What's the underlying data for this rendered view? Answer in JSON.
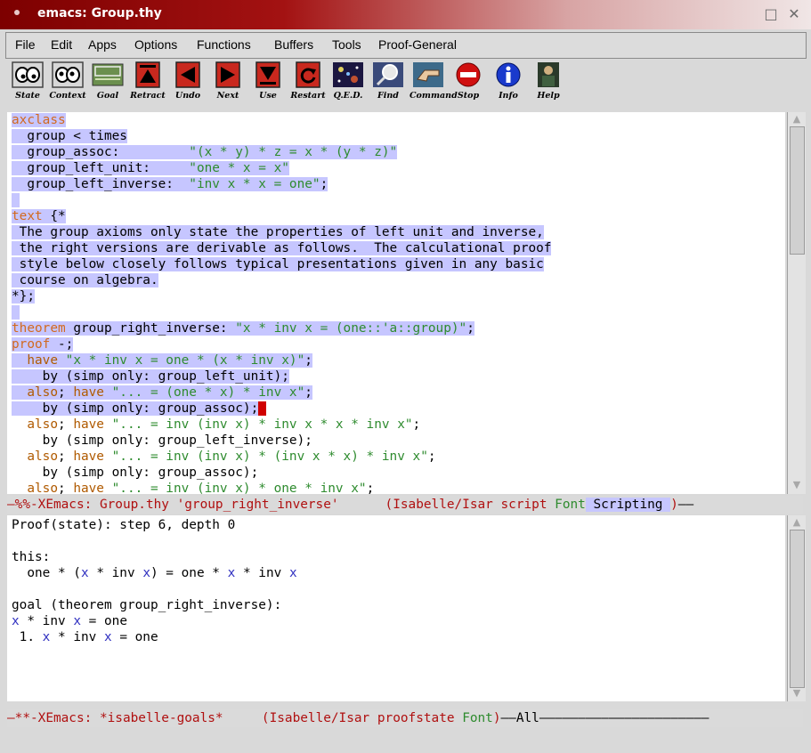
{
  "window": {
    "title": "emacs: Group.thy",
    "maximize_glyph": "□",
    "close_glyph": "✕"
  },
  "menu": {
    "items": [
      "File",
      "Edit",
      "Apps",
      "Options",
      "Functions",
      "Buffers",
      "Tools",
      "Proof-General"
    ],
    "help": "Help"
  },
  "toolbar": {
    "buttons": [
      {
        "label": "State",
        "icon": "eyes-icon"
      },
      {
        "label": "Context",
        "icon": "eyes-context-icon"
      },
      {
        "label": "Goal",
        "icon": "goal-icon"
      },
      {
        "label": "Retract",
        "icon": "retract-icon"
      },
      {
        "label": "Undo",
        "icon": "undo-icon"
      },
      {
        "label": "Next",
        "icon": "next-icon"
      },
      {
        "label": "Use",
        "icon": "use-icon"
      },
      {
        "label": "Restart",
        "icon": "restart-icon"
      },
      {
        "label": "Q.E.D.",
        "icon": "qed-icon"
      },
      {
        "label": "Find",
        "icon": "find-icon"
      },
      {
        "label": "Command",
        "icon": "command-icon"
      },
      {
        "label": "Stop",
        "icon": "stop-icon"
      },
      {
        "label": "Info",
        "icon": "info-icon"
      },
      {
        "label": "Help",
        "icon": "help-icon"
      }
    ]
  },
  "script": {
    "lines": [
      {
        "hl": true,
        "segs": [
          {
            "c": "kw",
            "t": "axclass"
          }
        ]
      },
      {
        "hl": true,
        "segs": [
          {
            "c": "",
            "t": "  group < times"
          }
        ]
      },
      {
        "hl": true,
        "segs": [
          {
            "c": "",
            "t": "  group_assoc:         "
          },
          {
            "c": "str",
            "t": "\"(x * y) * z = x * (y * z)\""
          }
        ]
      },
      {
        "hl": true,
        "segs": [
          {
            "c": "",
            "t": "  group_left_unit:     "
          },
          {
            "c": "str",
            "t": "\"one * x = x\""
          }
        ]
      },
      {
        "hl": true,
        "segs": [
          {
            "c": "",
            "t": "  group_left_inverse:  "
          },
          {
            "c": "str",
            "t": "\"inv x * x = one\""
          },
          {
            "c": "",
            "t": ";"
          }
        ]
      },
      {
        "hl": true,
        "segs": [
          {
            "c": "",
            "t": ""
          }
        ]
      },
      {
        "hl": true,
        "segs": [
          {
            "c": "kw",
            "t": "text"
          },
          {
            "c": "",
            "t": " {*"
          }
        ]
      },
      {
        "hl": true,
        "segs": [
          {
            "c": "",
            "t": " The group axioms only state the properties of left unit and inverse,"
          }
        ]
      },
      {
        "hl": true,
        "segs": [
          {
            "c": "",
            "t": " the right versions are derivable as follows.  The calculational proof"
          }
        ]
      },
      {
        "hl": true,
        "segs": [
          {
            "c": "",
            "t": " style below closely follows typical presentations given in any basic"
          }
        ]
      },
      {
        "hl": true,
        "segs": [
          {
            "c": "",
            "t": " course on algebra."
          }
        ]
      },
      {
        "hl": true,
        "segs": [
          {
            "c": "",
            "t": "*};"
          }
        ]
      },
      {
        "hl": true,
        "segs": [
          {
            "c": "",
            "t": ""
          }
        ]
      },
      {
        "hl": true,
        "segs": [
          {
            "c": "kw",
            "t": "theorem"
          },
          {
            "c": "",
            "t": " group_right_inverse: "
          },
          {
            "c": "str",
            "t": "\"x * inv x = (one::'a::group)\""
          },
          {
            "c": "",
            "t": ";"
          }
        ]
      },
      {
        "hl": true,
        "segs": [
          {
            "c": "kw",
            "t": "proof"
          },
          {
            "c": "",
            "t": " -;"
          }
        ]
      },
      {
        "hl": true,
        "segs": [
          {
            "c": "ph",
            "t": "  have"
          },
          {
            "c": "",
            "t": " "
          },
          {
            "c": "str",
            "t": "\"x * inv x = one * (x * inv x)\""
          },
          {
            "c": "",
            "t": ";"
          }
        ]
      },
      {
        "hl": true,
        "segs": [
          {
            "c": "",
            "t": "    by (simp only: group_left_unit);"
          }
        ]
      },
      {
        "hl": true,
        "segs": [
          {
            "c": "ph",
            "t": "  also"
          },
          {
            "c": "",
            "t": "; "
          },
          {
            "c": "ph",
            "t": "have"
          },
          {
            "c": "",
            "t": " "
          },
          {
            "c": "str",
            "t": "\"... = (one * x) * inv x\""
          },
          {
            "c": "",
            "t": ";"
          }
        ]
      },
      {
        "hl": true,
        "cursor": true,
        "segs": [
          {
            "c": "",
            "t": "    by (simp only: group_assoc);"
          }
        ]
      },
      {
        "hl": false,
        "segs": [
          {
            "c": "ph",
            "t": "  also"
          },
          {
            "c": "",
            "t": "; "
          },
          {
            "c": "ph",
            "t": "have"
          },
          {
            "c": "",
            "t": " "
          },
          {
            "c": "str",
            "t": "\"... = inv (inv x) * inv x * x * inv x\""
          },
          {
            "c": "",
            "t": ";"
          }
        ]
      },
      {
        "hl": false,
        "segs": [
          {
            "c": "",
            "t": "    by (simp only: group_left_inverse);"
          }
        ]
      },
      {
        "hl": false,
        "segs": [
          {
            "c": "ph",
            "t": "  also"
          },
          {
            "c": "",
            "t": "; "
          },
          {
            "c": "ph",
            "t": "have"
          },
          {
            "c": "",
            "t": " "
          },
          {
            "c": "str",
            "t": "\"... = inv (inv x) * (inv x * x) * inv x\""
          },
          {
            "c": "",
            "t": ";"
          }
        ]
      },
      {
        "hl": false,
        "segs": [
          {
            "c": "",
            "t": "    by (simp only: group_assoc);"
          }
        ]
      },
      {
        "hl": false,
        "segs": [
          {
            "c": "ph",
            "t": "  also"
          },
          {
            "c": "",
            "t": "; "
          },
          {
            "c": "ph",
            "t": "have"
          },
          {
            "c": "",
            "t": " "
          },
          {
            "c": "str",
            "t": "\"... = inv (inv x) * one * inv x\""
          },
          {
            "c": "",
            "t": ";"
          }
        ]
      }
    ]
  },
  "modeline1": {
    "prefix": "—%%-",
    "buffer": "XEmacs: Group.thy 'group_right_inverse'",
    "mode_open": "(Isabelle/Isar script ",
    "font": "Font",
    "scripting": " Scripting ",
    "mode_close": ")",
    "tail": "——"
  },
  "goals": {
    "lines": [
      {
        "segs": [
          {
            "c": "",
            "t": "Proof(state): step 6, depth 0"
          }
        ]
      },
      {
        "segs": [
          {
            "c": "",
            "t": ""
          }
        ]
      },
      {
        "segs": [
          {
            "c": "",
            "t": "this:"
          }
        ]
      },
      {
        "segs": [
          {
            "c": "",
            "t": "  one * ("
          },
          {
            "c": "var",
            "t": "x"
          },
          {
            "c": "",
            "t": " * inv "
          },
          {
            "c": "var",
            "t": "x"
          },
          {
            "c": "",
            "t": ") = one * "
          },
          {
            "c": "var",
            "t": "x"
          },
          {
            "c": "",
            "t": " * inv "
          },
          {
            "c": "var",
            "t": "x"
          }
        ]
      },
      {
        "segs": [
          {
            "c": "",
            "t": ""
          }
        ]
      },
      {
        "segs": [
          {
            "c": "",
            "t": "goal (theorem group_right_inverse):"
          }
        ]
      },
      {
        "segs": [
          {
            "c": "var",
            "t": "x"
          },
          {
            "c": "",
            "t": " * inv "
          },
          {
            "c": "var",
            "t": "x"
          },
          {
            "c": "",
            "t": " = one"
          }
        ]
      },
      {
        "segs": [
          {
            "c": "",
            "t": " 1. "
          },
          {
            "c": "var",
            "t": "x"
          },
          {
            "c": "",
            "t": " * inv "
          },
          {
            "c": "var",
            "t": "x"
          },
          {
            "c": "",
            "t": " = one"
          }
        ]
      }
    ]
  },
  "modeline2": {
    "prefix": "—**-",
    "buffer": "XEmacs: *isabelle-goals*",
    "mode_open": "(Isabelle/Isar proofstate ",
    "font": "Font",
    "mode_close": ")",
    "position": "All",
    "tail": "——————————————————————"
  },
  "colors": {
    "highlight": "#c6c6ff",
    "keyword": "#d2691e",
    "string": "#2e8b2e",
    "variable": "#3030c0",
    "titlebar": "#a31212"
  }
}
